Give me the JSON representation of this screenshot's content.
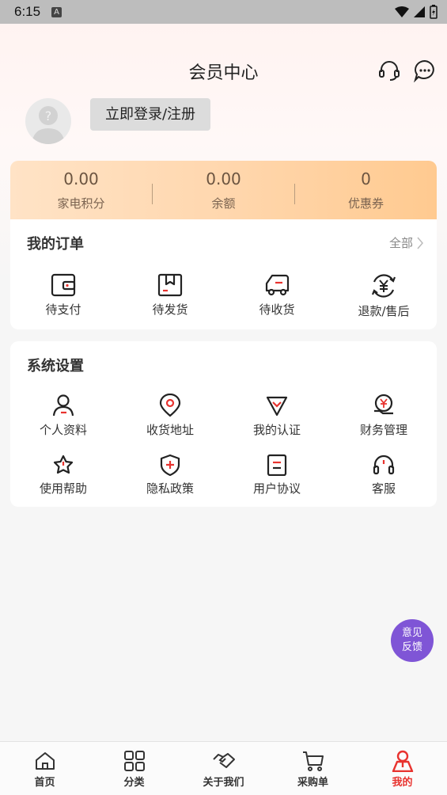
{
  "status_bar": {
    "time": "6:15"
  },
  "header": {
    "title": "会员中心"
  },
  "login": {
    "button_label": "立即登录/注册"
  },
  "stats": [
    {
      "value": "0.00",
      "label": "家电积分"
    },
    {
      "value": "0.00",
      "label": "余额"
    },
    {
      "value": "0",
      "label": "优惠券"
    }
  ],
  "orders": {
    "title": "我的订单",
    "more_label": "全部",
    "items": [
      {
        "label": "待支付",
        "icon": "wallet-icon"
      },
      {
        "label": "待发货",
        "icon": "package-icon"
      },
      {
        "label": "待收货",
        "icon": "delivery-truck-icon"
      },
      {
        "label": "退款/售后",
        "icon": "refund-icon"
      }
    ]
  },
  "settings": {
    "title": "系统设置",
    "items": [
      {
        "label": "个人资料",
        "icon": "person-icon"
      },
      {
        "label": "收货地址",
        "icon": "location-pin-icon"
      },
      {
        "label": "我的认证",
        "icon": "verification-icon"
      },
      {
        "label": "财务管理",
        "icon": "finance-icon"
      },
      {
        "label": "使用帮助",
        "icon": "help-icon"
      },
      {
        "label": "隐私政策",
        "icon": "privacy-shield-icon"
      },
      {
        "label": "用户协议",
        "icon": "agreement-icon"
      },
      {
        "label": "客服",
        "icon": "headset-icon"
      }
    ]
  },
  "feedback": {
    "line1": "意见",
    "line2": "反馈",
    "color": "#7f55d6"
  },
  "tabbar": {
    "active_color": "#e8332f",
    "items": [
      {
        "label": "首页",
        "icon": "home-icon"
      },
      {
        "label": "分类",
        "icon": "category-grid-icon"
      },
      {
        "label": "关于我们",
        "icon": "handshake-icon"
      },
      {
        "label": "采购单",
        "icon": "cart-icon"
      },
      {
        "label": "我的",
        "icon": "profile-icon",
        "active": true
      }
    ]
  }
}
